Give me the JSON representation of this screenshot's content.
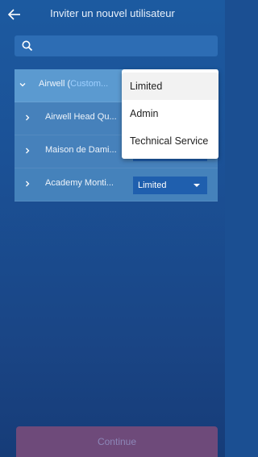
{
  "header": {
    "title": "Inviter un nouvel utilisateur",
    "back_icon": "arrow-left-icon"
  },
  "search": {
    "placeholder": "",
    "icon": "search-icon"
  },
  "list": {
    "parent": {
      "name": "Airwell (",
      "badge": "Custom...",
      "expanded": true
    },
    "children": [
      {
        "name": "Airwell Head Qu...",
        "role": ""
      },
      {
        "name": "Maison de Dami...",
        "role": ""
      },
      {
        "name": "Academy Monti...",
        "role": "Limited"
      }
    ]
  },
  "dropdown": {
    "options": [
      "Limited",
      "Admin",
      "Technical Service"
    ],
    "selected": "Limited"
  },
  "footer": {
    "continue_label": "Continue"
  },
  "colors": {
    "background": "#1b5196",
    "row": "#4f8cc6",
    "select": "#1f5fae",
    "continue_button": "#6e4a7a"
  }
}
